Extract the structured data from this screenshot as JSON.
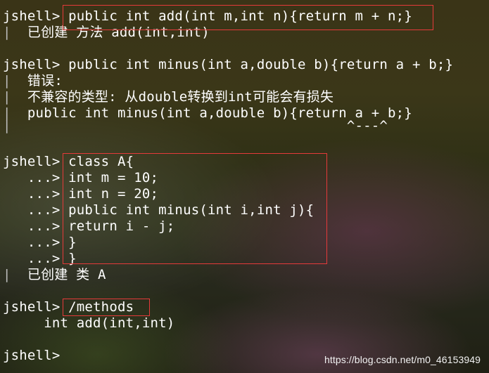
{
  "terminal": {
    "lines": [
      {
        "prompt": "jshell>",
        "text": " public int add(int m,int n){return m + n;}"
      },
      {
        "prompt": "|",
        "text": "  已创建 方法 add(int,int)"
      },
      {
        "prompt": "",
        "text": ""
      },
      {
        "prompt": "jshell>",
        "text": " public int minus(int a,double b){return a + b;}"
      },
      {
        "prompt": "|",
        "text": "  错误:"
      },
      {
        "prompt": "|",
        "text": "  不兼容的类型: 从double转换到int可能会有损失"
      },
      {
        "prompt": "|",
        "text": "  public int minus(int a,double b){return a + b;}"
      },
      {
        "prompt": "|",
        "text": "                                         ^---^"
      },
      {
        "prompt": "",
        "text": ""
      },
      {
        "prompt": "jshell>",
        "text": " class A{"
      },
      {
        "prompt": "   ...>",
        "text": " int m = 10;"
      },
      {
        "prompt": "   ...>",
        "text": " int n = 20;"
      },
      {
        "prompt": "   ...>",
        "text": " public int minus(int i,int j){"
      },
      {
        "prompt": "   ...>",
        "text": " return i - j;"
      },
      {
        "prompt": "   ...>",
        "text": " }"
      },
      {
        "prompt": "   ...>",
        "text": " }"
      },
      {
        "prompt": "|",
        "text": "  已创建 类 A"
      },
      {
        "prompt": "",
        "text": ""
      },
      {
        "prompt": "jshell>",
        "text": " /methods"
      },
      {
        "prompt": "|",
        "text": "    int add(int,int)"
      },
      {
        "prompt": "",
        "text": ""
      },
      {
        "prompt": "jshell>",
        "text": ""
      }
    ]
  },
  "watermark": "https://blog.csdn.net/m0_46153949",
  "colors": {
    "highlight_border": "#e53a3a",
    "text": "#ffffff"
  }
}
